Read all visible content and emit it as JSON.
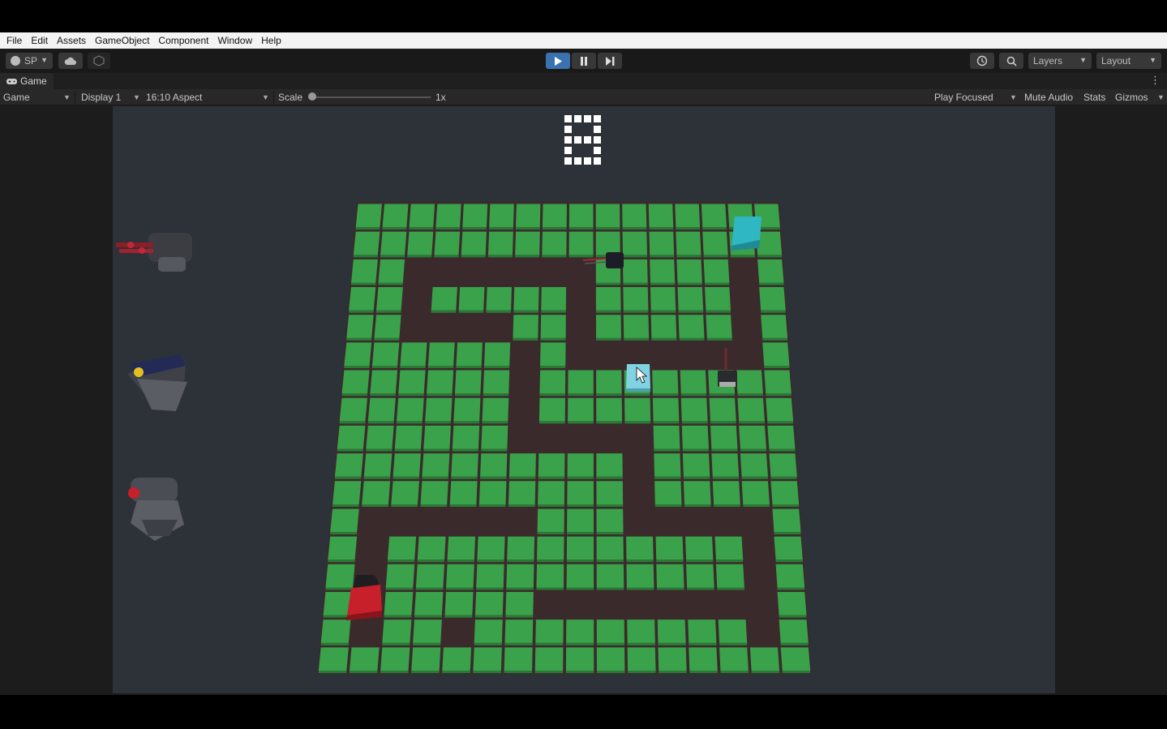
{
  "menu": [
    "File",
    "Edit",
    "Assets",
    "GameObject",
    "Component",
    "Window",
    "Help"
  ],
  "toolbar": {
    "account_label": "SP",
    "layers_label": "Layers",
    "layout_label": "Layout"
  },
  "tab": {
    "label": "Game"
  },
  "game_bar": {
    "view_select": "Game",
    "display_select": "Display 1",
    "aspect_select": "16:10 Aspect",
    "scale_label": "Scale",
    "scale_value": "1x",
    "play_focused": "Play Focused",
    "mute_audio": "Mute Audio",
    "stats": "Stats",
    "gizmos": "Gizmos"
  },
  "game": {
    "score": "8",
    "path_color": "#3b2a2c",
    "tile_color": "#3aa24a",
    "start_color": "#2fb7c4",
    "end_color": "#c8202a",
    "selected_color": "#7fd3e3",
    "towers": [
      "turret-gatling",
      "turret-cannon",
      "turret-laser"
    ]
  }
}
